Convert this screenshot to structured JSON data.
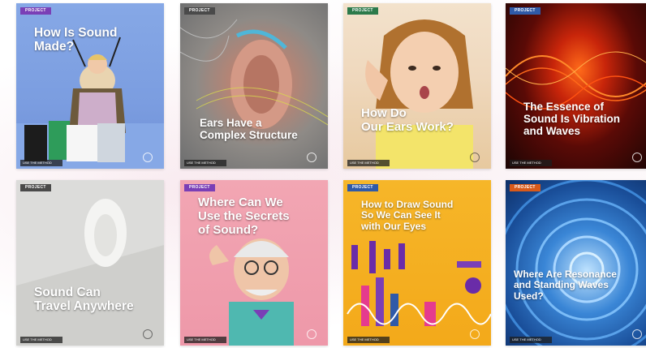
{
  "cards": [
    {
      "tag": "PROJECT",
      "title": "How Is Sound\nMade?",
      "footer": "USE THE METHOD",
      "accent": "#7a3fb6"
    },
    {
      "tag": "PROJECT",
      "title": "Ears Have a\nComplex Structure",
      "footer": "USE THE METHOD",
      "accent": "#4a4a4a"
    },
    {
      "tag": "PROJECT",
      "title": "How Do\nOur Ears Work?",
      "footer": "USE THE METHOD",
      "accent": "#2c7a4b"
    },
    {
      "tag": "PROJECT",
      "title": "The Essence of\nSound Is Vibration\nand Waves",
      "footer": "USE THE METHOD",
      "accent": "#2f5aa8"
    },
    {
      "tag": "PROJECT",
      "title": "Sound Can\nTravel Anywhere",
      "footer": "USE THE METHOD",
      "accent": "#4a4a4a"
    },
    {
      "tag": "PROJECT",
      "title": "Where Can We\nUse the Secrets\nof Sound?",
      "footer": "USE THE METHOD",
      "accent": "#7a3fb6"
    },
    {
      "tag": "PROJECT",
      "title": "How to Draw Sound\nSo We Can See It\nwith Our Eyes",
      "footer": "USE THE METHOD",
      "accent": "#2f5aa8"
    },
    {
      "tag": "PROJECT",
      "title": "Where Are Resonance\nand Standing Waves\nUsed?",
      "footer": "USE THE METHOD",
      "accent": "#d95a1a"
    }
  ]
}
